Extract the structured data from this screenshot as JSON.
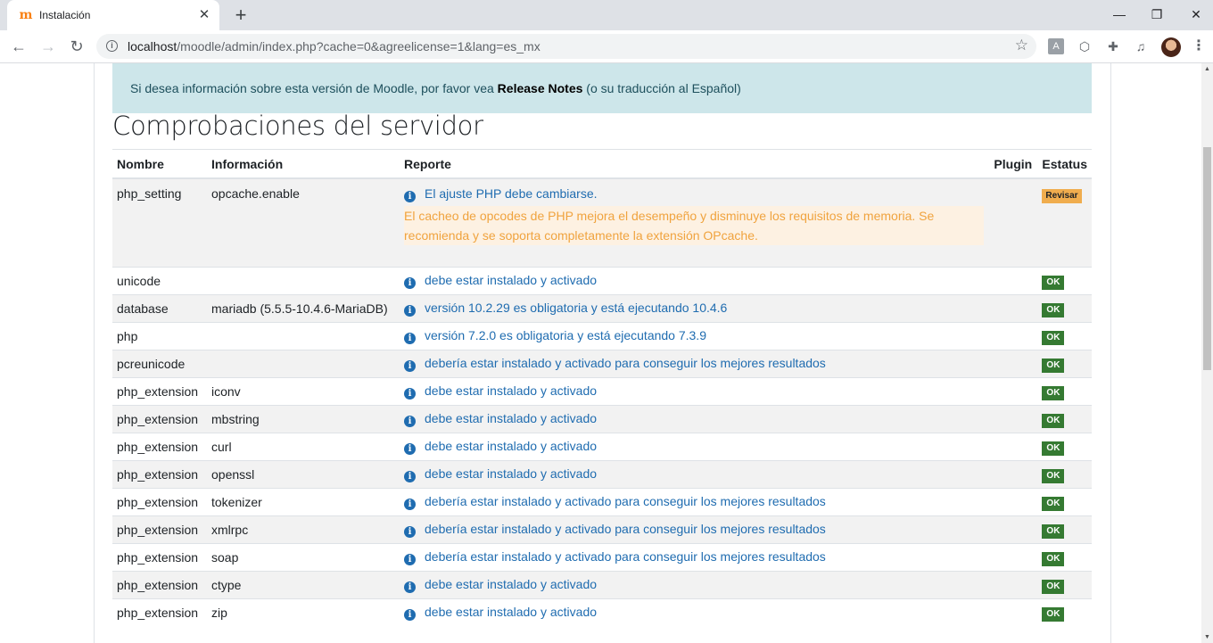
{
  "browser": {
    "tab_title": "Instalación",
    "tab_favicon": "m",
    "new_tab_glyph": "+",
    "url_host": "localhost",
    "url_rest": "/moodle/admin/index.php?cache=0&agreelicense=1&lang=es_mx"
  },
  "alert": {
    "text_before": "Si desea información sobre esta versión de Moodle, por favor vea ",
    "link": "Release Notes",
    "text_after": " (o su traducción al Español)"
  },
  "section_title": "Comprobaciones del servidor",
  "table": {
    "headers": {
      "nombre": "Nombre",
      "informacion": "Información",
      "reporte": "Reporte",
      "plugin": "Plugin",
      "estatus": "Estatus"
    },
    "first_row": {
      "nombre": "php_setting",
      "informacion": "opcache.enable",
      "reporte": "El ajuste PHP debe cambiarse.",
      "warning": "El cacheo de opcodes de PHP mejora el desempeño y disminuye los requisitos de memoria. Se recomienda y se soporta completamente la extensión OPcache.",
      "estatus": "Revisar"
    },
    "rows": [
      {
        "nombre": "unicode",
        "informacion": "",
        "reporte": "debe estar instalado y activado",
        "estatus": "OK"
      },
      {
        "nombre": "database",
        "informacion": "mariadb (5.5.5-10.4.6-MariaDB)",
        "reporte": "versión 10.2.29 es obligatoria y está ejecutando 10.4.6",
        "estatus": "OK"
      },
      {
        "nombre": "php",
        "informacion": "",
        "reporte": "versión 7.2.0 es obligatoria y está ejecutando 7.3.9",
        "estatus": "OK"
      },
      {
        "nombre": "pcreunicode",
        "informacion": "",
        "reporte": "debería estar instalado y activado para conseguir los mejores resultados",
        "estatus": "OK"
      },
      {
        "nombre": "php_extension",
        "informacion": "iconv",
        "reporte": "debe estar instalado y activado",
        "estatus": "OK"
      },
      {
        "nombre": "php_extension",
        "informacion": "mbstring",
        "reporte": "debe estar instalado y activado",
        "estatus": "OK"
      },
      {
        "nombre": "php_extension",
        "informacion": "curl",
        "reporte": "debe estar instalado y activado",
        "estatus": "OK"
      },
      {
        "nombre": "php_extension",
        "informacion": "openssl",
        "reporte": "debe estar instalado y activado",
        "estatus": "OK"
      },
      {
        "nombre": "php_extension",
        "informacion": "tokenizer",
        "reporte": "debería estar instalado y activado para conseguir los mejores resultados",
        "estatus": "OK"
      },
      {
        "nombre": "php_extension",
        "informacion": "xmlrpc",
        "reporte": "debería estar instalado y activado para conseguir los mejores resultados",
        "estatus": "OK"
      },
      {
        "nombre": "php_extension",
        "informacion": "soap",
        "reporte": "debería estar instalado y activado para conseguir los mejores resultados",
        "estatus": "OK"
      },
      {
        "nombre": "php_extension",
        "informacion": "ctype",
        "reporte": "debe estar instalado y activado",
        "estatus": "OK"
      },
      {
        "nombre": "php_extension",
        "informacion": "zip",
        "reporte": "debe estar instalado y activado",
        "estatus": "OK"
      }
    ]
  },
  "colors": {
    "link": "#1f6cb0",
    "ok_badge": "#357a32",
    "revisar_badge": "#f0ad4e",
    "alert_bg": "#cde6ea",
    "warning_text": "#f0a33e"
  },
  "icons": {
    "info": "info-icon",
    "back": "back-arrow-icon",
    "forward": "forward-arrow-icon",
    "reload": "reload-icon",
    "star": "bookmark-star-icon"
  }
}
